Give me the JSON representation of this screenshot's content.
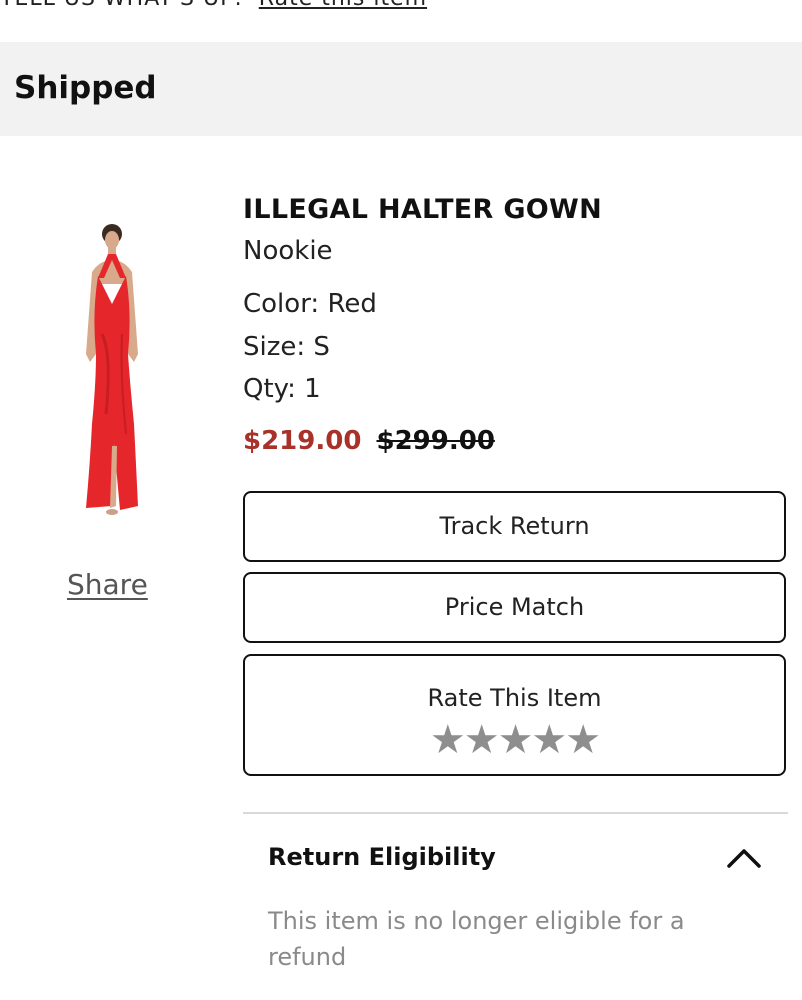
{
  "top": {
    "partial_text": "TELL US WHAT'S UP:",
    "rate_link": "Rate this item"
  },
  "status": {
    "label": "Shipped"
  },
  "product": {
    "image_icon": "red-halter-gown-image",
    "share_label": "Share",
    "name": "ILLEGAL HALTER GOWN",
    "brand": "Nookie",
    "color": "Color: Red",
    "size": "Size: S",
    "qty": "Qty: 1",
    "sale_price": "$219.00",
    "original_price": "$299.00"
  },
  "actions": {
    "track_return": "Track Return",
    "price_match": "Price Match",
    "rate_item": "Rate This Item",
    "stars": "★★★★★",
    "rating_value": 0,
    "rating_max": 5
  },
  "eligibility": {
    "title": "Return Eligibility",
    "text": "This item is no longer eligible for a refund",
    "toggle_icon": "chevron-up-icon"
  },
  "colors": {
    "sale": "#a8312a",
    "status_bg": "#f2f2f2",
    "star": "#8e8e8e",
    "muted_text": "#8a8a8a"
  }
}
